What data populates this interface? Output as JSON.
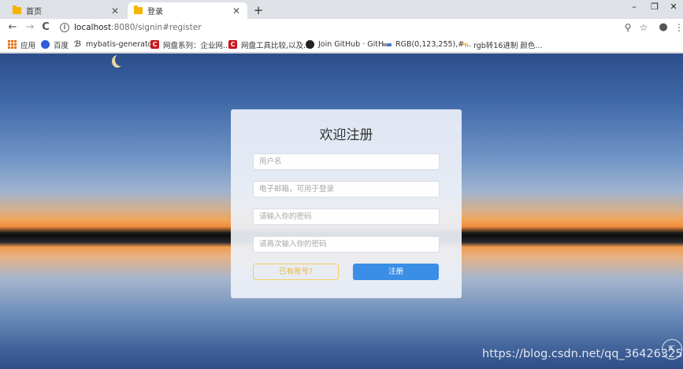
{
  "tabs": [
    {
      "title": "首页",
      "active": false
    },
    {
      "title": "登录",
      "active": true
    }
  ],
  "newtab_label": "+",
  "window_controls": {
    "minimize": "–",
    "restore": "❐",
    "close": "✕"
  },
  "nav": {
    "back": "←",
    "forward": "→",
    "reload": "C"
  },
  "address": {
    "host": "localhost",
    "rest": ":8080/signin#register"
  },
  "toolbar_icons": {
    "zoom": "⚲",
    "star": "☆",
    "account": "●",
    "menu": "⋮"
  },
  "bookmarks": [
    {
      "label": "应用",
      "icon": "apps-icon"
    },
    {
      "label": "百度",
      "icon": "baidu-icon"
    },
    {
      "label": "mybatis-generato...",
      "icon": "mybatis-icon"
    },
    {
      "label": "网盘系列：企业网...",
      "icon": "csdn-icon"
    },
    {
      "label": "网盘工具比较,以及...",
      "icon": "csdn-icon"
    },
    {
      "label": "Join GitHub · GitH...",
      "icon": "github-icon"
    },
    {
      "label": "RGB(0,123,255),#...",
      "icon": "rgb-icon"
    },
    {
      "label": "rgb转16进制 颜色...",
      "icon": "tool-icon"
    }
  ],
  "form": {
    "title": "欢迎注册",
    "username_placeholder": "用户名",
    "email_placeholder": "电子邮箱，可用于登录",
    "password_placeholder": "请输入你的密码",
    "confirm_placeholder": "请再次输入你的密码",
    "login_link_label": "已有账号?",
    "register_button_label": "注册"
  },
  "watermark": "https://blog.csdn.net/qq_36426325",
  "colors": {
    "primary_button": "#3a8ee6",
    "secondary_border": "#f5cc5a"
  }
}
